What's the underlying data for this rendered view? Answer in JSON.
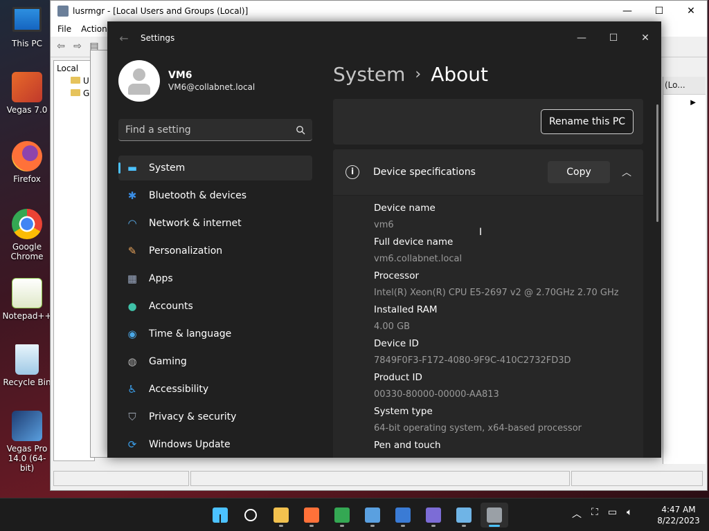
{
  "desktop": {
    "icons": [
      {
        "label": "This PC"
      },
      {
        "label": "Vegas 7.0"
      },
      {
        "label": "Firefox"
      },
      {
        "label": "Google Chrome"
      },
      {
        "label": "Notepad++"
      },
      {
        "label": "Recycle Bin"
      },
      {
        "label": "Vegas Pro 14.0 (64-bit)"
      }
    ]
  },
  "lusrmgr": {
    "title": "lusrmgr - [Local Users and Groups (Local)]",
    "menu": [
      "File",
      "Action"
    ],
    "tree": [
      "Local",
      "U",
      "G"
    ],
    "right_header": "(Lo...",
    "min": "—",
    "max": "☐",
    "close": "✕"
  },
  "settings": {
    "title": "Settings",
    "back": "←",
    "min": "—",
    "max": "☐",
    "close": "✕",
    "profile": {
      "name": "VM6",
      "email": "VM6@collabnet.local"
    },
    "search_placeholder": "Find a setting",
    "nav": [
      {
        "label": "System",
        "icon": "system-icon",
        "glyph": "▬",
        "color": "#4cc2ff",
        "active": true
      },
      {
        "label": "Bluetooth & devices",
        "icon": "bluetooth-icon",
        "glyph": "✱",
        "color": "#3a8ee6"
      },
      {
        "label": "Network & internet",
        "icon": "wifi-icon",
        "glyph": "◠",
        "color": "#5ab0f0"
      },
      {
        "label": "Personalization",
        "icon": "brush-icon",
        "glyph": "✎",
        "color": "#e8a35a"
      },
      {
        "label": "Apps",
        "icon": "apps-icon",
        "glyph": "▦",
        "color": "#9aa7c0"
      },
      {
        "label": "Accounts",
        "icon": "accounts-icon",
        "glyph": "●",
        "color": "#3fc1a8"
      },
      {
        "label": "Time & language",
        "icon": "globe-icon",
        "glyph": "◉",
        "color": "#4aa8e8"
      },
      {
        "label": "Gaming",
        "icon": "gamepad-icon",
        "glyph": "◍",
        "color": "#b0b0b0"
      },
      {
        "label": "Accessibility",
        "icon": "accessibility-icon",
        "glyph": "♿",
        "color": "#3a9de8"
      },
      {
        "label": "Privacy & security",
        "icon": "shield-icon",
        "glyph": "⛉",
        "color": "#a0a8b4"
      },
      {
        "label": "Windows Update",
        "icon": "update-icon",
        "glyph": "⟳",
        "color": "#3a9de8"
      }
    ],
    "breadcrumb": {
      "parent": "System",
      "separator": "›",
      "current": "About"
    },
    "rename_button": "Rename this PC",
    "device_specs": {
      "label": "Device specifications",
      "copy_button": "Copy",
      "rows": [
        {
          "key": "Device name",
          "value": "vm6"
        },
        {
          "key": "Full device name",
          "value": "vm6.collabnet.local"
        },
        {
          "key": "Processor",
          "value": "Intel(R) Xeon(R) CPU E5-2697 v2 @ 2.70GHz   2.70 GHz"
        },
        {
          "key": "Installed RAM",
          "value": "4.00 GB"
        },
        {
          "key": "Device ID",
          "value": "7849F0F3-F172-4080-9F9C-410C2732FD3D"
        },
        {
          "key": "Product ID",
          "value": "00330-80000-00000-AA813"
        },
        {
          "key": "System type",
          "value": "64-bit operating system, x64-based processor"
        },
        {
          "key": "Pen and touch",
          "value": ""
        }
      ]
    }
  },
  "taskbar": {
    "apps": [
      {
        "name": "start-button",
        "color": "#4cc2ff"
      },
      {
        "name": "search-button",
        "color": "#ffffff"
      },
      {
        "name": "file-explorer",
        "color": "#f2c14e"
      },
      {
        "name": "firefox",
        "color": "#ff7139"
      },
      {
        "name": "chrome",
        "color": "#34a853"
      },
      {
        "name": "vegas",
        "color": "#5aa0e0"
      },
      {
        "name": "network-tool",
        "color": "#3a7bd5"
      },
      {
        "name": "control-panel",
        "color": "#7c6cd6"
      },
      {
        "name": "remote-desktop",
        "color": "#6fb4e6"
      },
      {
        "name": "settings",
        "color": "#9aa0a6",
        "active": true
      }
    ],
    "time": "4:47 AM",
    "date": "8/22/2023"
  }
}
